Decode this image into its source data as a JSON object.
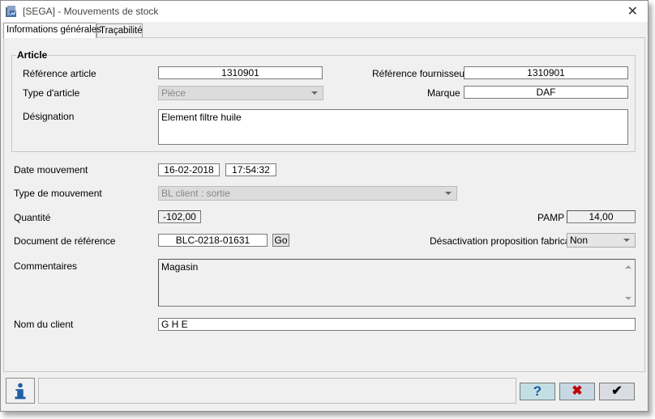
{
  "window": {
    "title": "[SEGA] - Mouvements de stock",
    "icons": {
      "app": "app-icon",
      "close": "close-icon"
    },
    "close_glyph": "✕"
  },
  "tabs": [
    {
      "label": "Informations générales",
      "active": true
    },
    {
      "label": "Traçabilité",
      "active": false
    }
  ],
  "article": {
    "group_title": "Article",
    "ref_label": "Référence article",
    "ref_value": "1310901",
    "supplier_ref_label": "Référence fournisseur",
    "supplier_ref_value": "1310901",
    "type_label": "Type d'article",
    "type_value": "Pièce",
    "brand_label": "Marque",
    "brand_value": "DAF",
    "designation_label": "Désignation",
    "designation_value": "Element filtre huile"
  },
  "movement": {
    "date_label": "Date mouvement",
    "date_value": "16-02-2018",
    "time_value": "17:54:32",
    "type_label": "Type de mouvement",
    "type_value": "BL client : sortie",
    "qty_label": "Quantité",
    "qty_value": "-102,00",
    "pamp_label": "PAMP",
    "pamp_value": "14,00",
    "docref_label": "Document de référence",
    "docref_value": "BLC-0218-01631",
    "go_label": "Go",
    "deactivation_label": "Désactivation proposition fabricant",
    "deactivation_value": "Non",
    "comments_label": "Commentaires",
    "comments_value": "Magasin",
    "client_label": "Nom du client",
    "client_value": "G H E"
  },
  "footer": {
    "info_icon": "info-icon",
    "help_icon": "help-icon",
    "help_glyph": "?",
    "cancel_icon": "cancel-icon",
    "cancel_glyph": "✖",
    "ok_icon": "checkmark-icon",
    "ok_glyph": "✔"
  },
  "colors": {
    "help_button": "#c4dfe3",
    "cancel_button": "#c7d7e4",
    "ok_button": "#d9dde1",
    "help_glyph": "#1a5aa8",
    "cancel_glyph": "#c00000",
    "info_icon": "#1e5fa8"
  }
}
